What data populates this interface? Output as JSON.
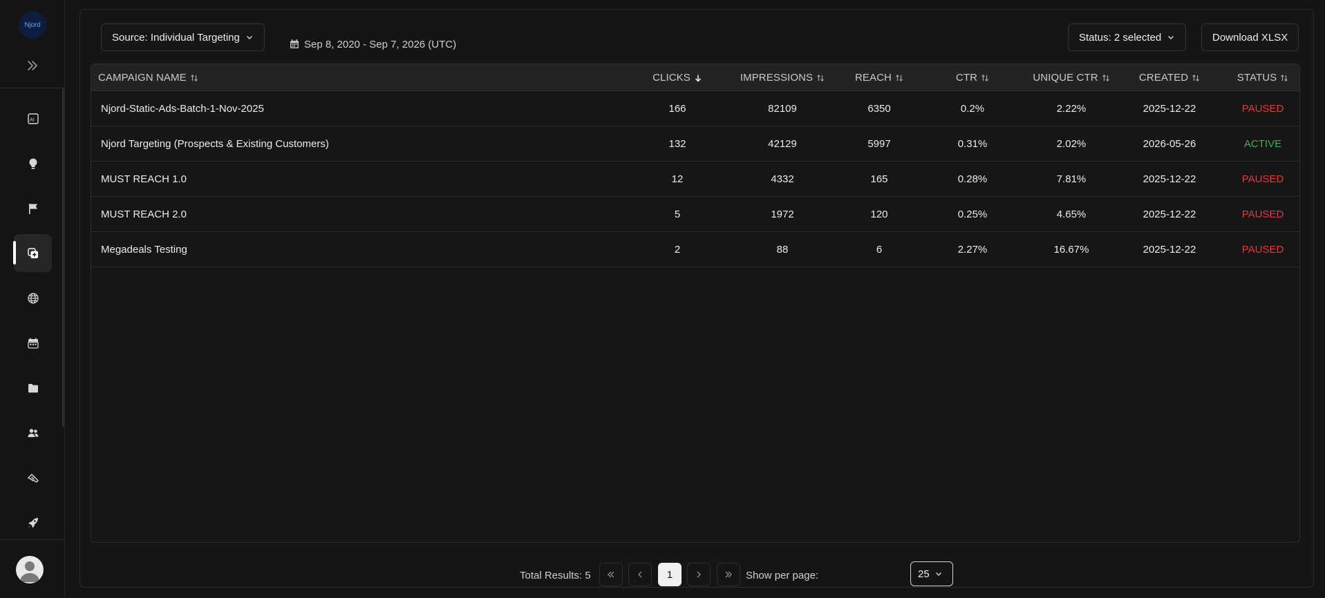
{
  "brand": {
    "logo_text": "Njord"
  },
  "sidebar": {
    "items": [
      {
        "name": "ai-icon"
      },
      {
        "name": "lightbulb-icon"
      },
      {
        "name": "flag-icon"
      },
      {
        "name": "add-copy-icon",
        "active": true
      },
      {
        "name": "globe-icon"
      },
      {
        "name": "calendar-icon"
      },
      {
        "name": "folder-icon"
      },
      {
        "name": "users-icon"
      },
      {
        "name": "handshake-icon"
      },
      {
        "name": "rocket-icon"
      }
    ]
  },
  "toolbar": {
    "source_label": "Source: Individual Targeting",
    "date_range": "Sep 8, 2020 - Sep 7, 2026 (UTC)",
    "status_label": "Status: 2 selected",
    "download_label": "Download XLSX"
  },
  "table": {
    "columns": [
      "CAMPAIGN NAME",
      "CLICKS",
      "IMPRESSIONS",
      "REACH",
      "CTR",
      "UNIQUE CTR",
      "CREATED",
      "STATUS"
    ],
    "rows": [
      {
        "name": "Njord-Static-Ads-Batch-1-Nov-2025",
        "clicks": "166",
        "impressions": "82109",
        "reach": "6350",
        "ctr": "0.2%",
        "unique_ctr": "2.22%",
        "created": "2025-12-22",
        "status": "PAUSED"
      },
      {
        "name": "Njord Targeting (Prospects & Existing Customers)",
        "clicks": "132",
        "impressions": "42129",
        "reach": "5997",
        "ctr": "0.31%",
        "unique_ctr": "2.02%",
        "created": "2026-05-26",
        "status": "ACTIVE"
      },
      {
        "name": "MUST REACH 1.0",
        "clicks": "12",
        "impressions": "4332",
        "reach": "165",
        "ctr": "0.28%",
        "unique_ctr": "7.81%",
        "created": "2025-12-22",
        "status": "PAUSED"
      },
      {
        "name": "MUST REACH 2.0",
        "clicks": "5",
        "impressions": "1972",
        "reach": "120",
        "ctr": "0.25%",
        "unique_ctr": "4.65%",
        "created": "2025-12-22",
        "status": "PAUSED"
      },
      {
        "name": "Megadeals Testing",
        "clicks": "2",
        "impressions": "88",
        "reach": "6",
        "ctr": "2.27%",
        "unique_ctr": "16.67%",
        "created": "2025-12-22",
        "status": "PAUSED"
      }
    ]
  },
  "pagination": {
    "total_label": "Total Results: 5",
    "current_page": "1",
    "per_page_label": "Show per page:",
    "per_page_value": "25"
  },
  "colors": {
    "paused": "#e0393e",
    "active": "#37b45c",
    "background": "#141414"
  }
}
